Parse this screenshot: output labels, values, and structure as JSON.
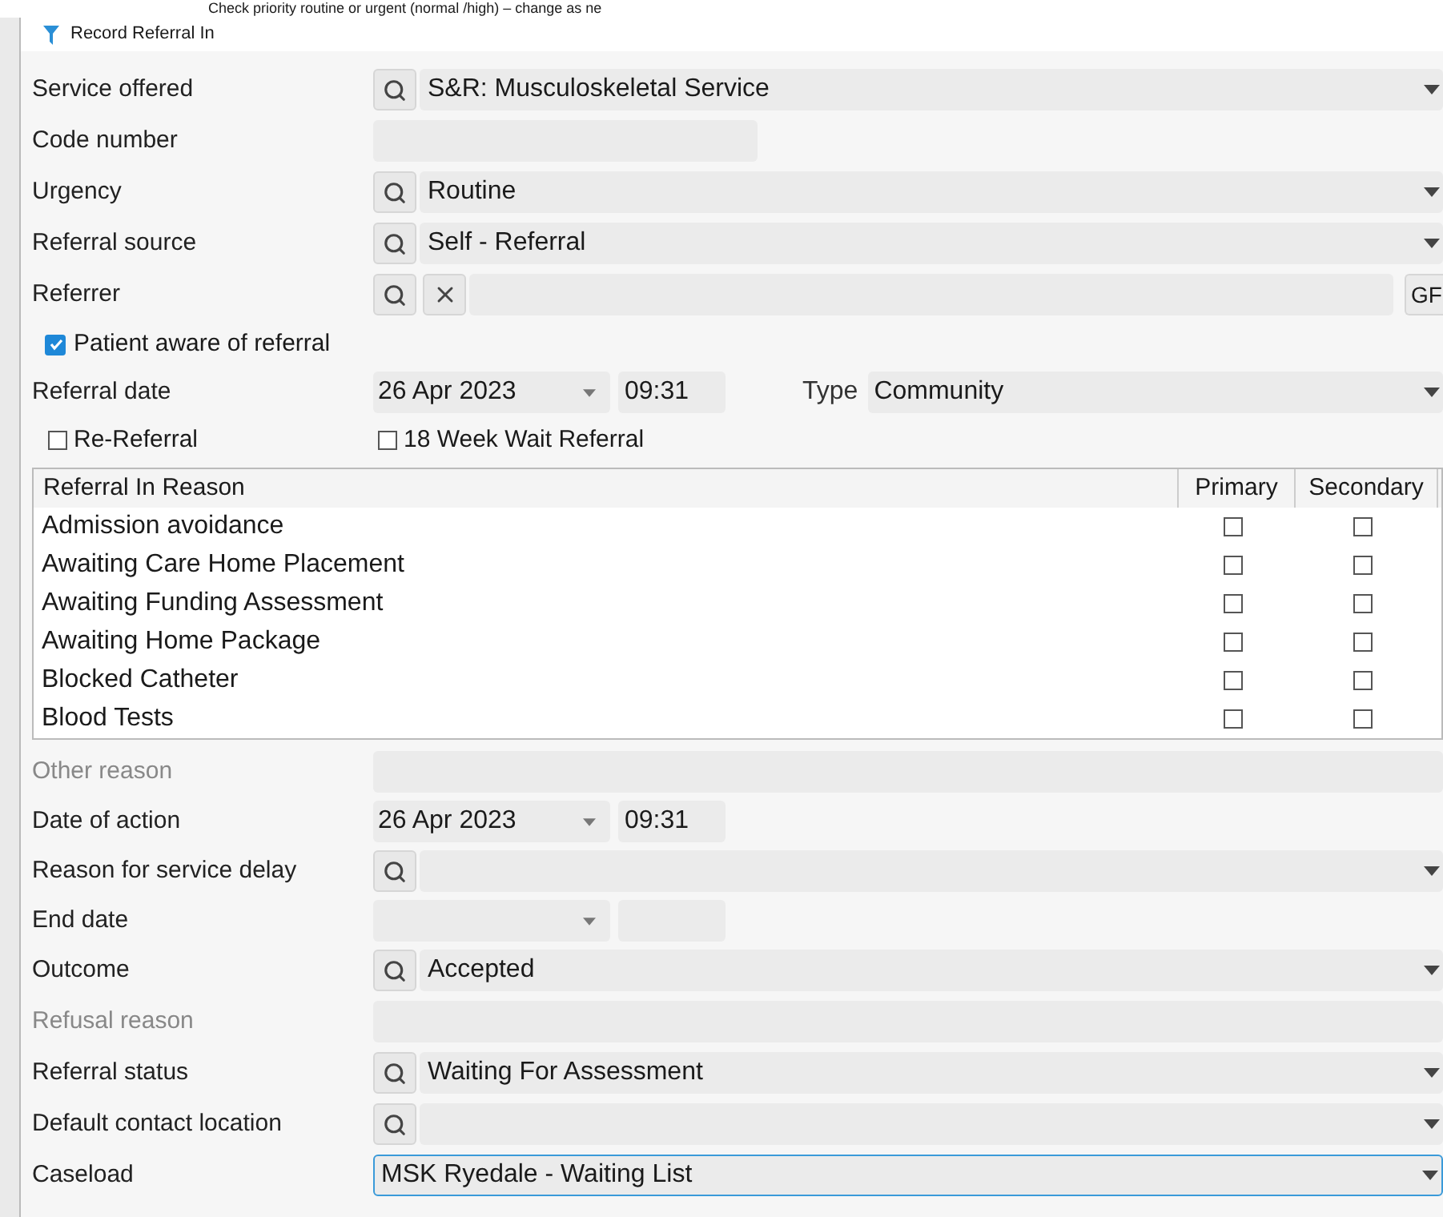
{
  "caption": "Check priority routine or urgent (normal /high) – change as ne",
  "window": {
    "title": "Record Referral In"
  },
  "top_fields": [
    {
      "kind": "lookup",
      "label": "Service offered",
      "value": "S&R: Musculoskeletal Service"
    },
    {
      "kind": "short",
      "label": "Code number"
    },
    {
      "kind": "lookup",
      "label": "Urgency",
      "value": "Routine"
    },
    {
      "kind": "lookup",
      "label": "Referral source",
      "value": "Self - Referral"
    },
    {
      "kind": "referrer",
      "label": "Referrer",
      "button": "GF"
    },
    {
      "kind": "checkbox",
      "label": "Patient aware of referral",
      "checked": true
    },
    {
      "kind": "datetime",
      "label": "Referral date",
      "date": "26 Apr 2023",
      "time": "09:31",
      "type_label": "Type",
      "type_value": "Community"
    },
    {
      "kind": "checkpair",
      "items": [
        {
          "label": "Re-Referral",
          "checked": false
        },
        {
          "label": "18 Week Wait Referral",
          "checked": false
        }
      ]
    }
  ],
  "table": {
    "columns": [
      "Referral In Reason",
      "Primary",
      "Secondary"
    ],
    "rows": [
      {
        "reason": "Admission avoidance",
        "primary": false,
        "secondary": false
      },
      {
        "reason": "Awaiting Care Home Placement",
        "primary": false,
        "secondary": false
      },
      {
        "reason": "Awaiting Funding Assessment",
        "primary": false,
        "secondary": false
      },
      {
        "reason": "Awaiting Home Package",
        "primary": false,
        "secondary": false
      },
      {
        "reason": "Blocked Catheter",
        "primary": false,
        "secondary": false
      },
      {
        "reason": "Blood Tests",
        "primary": false,
        "secondary": false
      }
    ]
  },
  "bottom_fields": [
    {
      "kind": "wide",
      "label": "Other reason",
      "disabled": true
    },
    {
      "kind": "datetime",
      "label": "Date of action",
      "date": "26 Apr 2023",
      "time": "09:31"
    },
    {
      "kind": "lookup",
      "label": "Reason for service delay"
    },
    {
      "kind": "datetime",
      "label": "End date"
    },
    {
      "kind": "lookup",
      "label": "Outcome",
      "value": "Accepted"
    },
    {
      "kind": "wide",
      "label": "Refusal reason",
      "disabled": true
    },
    {
      "kind": "lookup",
      "label": "Referral status",
      "value": "Waiting For Assessment"
    },
    {
      "kind": "lookup",
      "label": "Default contact location"
    },
    {
      "kind": "select",
      "label": "Caseload",
      "value": "MSK Ryedale - Waiting List",
      "focused": true
    }
  ]
}
